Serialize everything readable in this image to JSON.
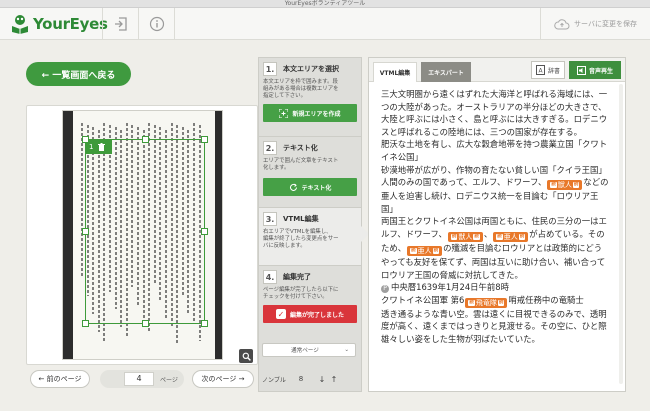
{
  "window": {
    "title": "YourEyesボランティアツール"
  },
  "header": {
    "logo_text": "YourEyes",
    "save_label": "サーバに変更を保存",
    "icons": [
      "exit-icon",
      "info-icon",
      "cloud-upload-icon"
    ]
  },
  "nav": {
    "back_label": "← 一覧画面へ戻る"
  },
  "image_panel": {
    "selection_number": "1",
    "pager": {
      "prev_label": "← 前のページ",
      "page": "4",
      "page_unit": "ページ",
      "next_label": "次のページ →"
    }
  },
  "steps": [
    {
      "num": "1.",
      "title": "本文エリアを選択",
      "desc": "本文エリアを枠で囲みます。段\n組みがある場合は複数エリアを\n指定して下さい。",
      "button": "新規エリアを作成"
    },
    {
      "num": "2.",
      "title": "テキスト化",
      "desc": "エリアで囲んだ文章をテキスト\n化します。",
      "button": "テキスト化"
    },
    {
      "num": "3.",
      "title": "VTML編集",
      "desc": "右エリアでVTMLを編集し、\n編集が終了したら変更点をサー\nバに反映します。",
      "button": ""
    },
    {
      "num": "4.",
      "title": "編集完了",
      "desc": "ページ編集が完了したら以下に\nチェックを付けて下さい。",
      "button": "編集が完了しました"
    }
  ],
  "view_mode": {
    "selected": "通常ページ"
  },
  "bottom_ctl": {
    "label": "ノンブル",
    "value": "8",
    "down": "↓",
    "up": "↑"
  },
  "editor": {
    "tabs": [
      "VTML編集",
      "エキスパート"
    ],
    "dict_label": "辞書",
    "speech_label": "音声再生",
    "tag_label": "読",
    "paragraphs": [
      "三大文明圏から遠くはずれた大海洋と呼ばれる海域には、一つの大陸があった。オーストラリアの半分ほどの大きさで、大陸と呼ぶには小さく、島と呼ぶには大きすぎる。ロデニウスと呼ばれるこの陸地には、三つの国家が存在する。",
      "肥沃な土地を有し、広大な穀倉地帯を持つ農業立国「クワトイネ公国」",
      "砂漠地帯が広がり、作物の育たない貧しい国「クイラ王国」"
    ],
    "p4_a": "人間のみの国であって、エルフ、ドワーフ、",
    "chip_juujin": "獣人",
    "p4_b": "などの亜人を迫害し続け、ロデニウス統一を目論む「ロウリア王国」",
    "p5_a": "両国王とクワトイネ公国は両国ともに、住民の三分の一はエルフ、ドワーフ、",
    "chip_juujin2": "獣人",
    "p5_b": "、",
    "chip_ajin": "亜人",
    "p5_c": "が占めている。そのため、",
    "chip_ajin2": "亜人",
    "p5_d": "の殲滅を目論むロウリアとは政策的にどうやっても友好を保てず、両国は互いに助け合い、補い合ってロウリア王国の脅威に対抗してきた。",
    "p6_pin": "P",
    "p6": "中央暦1639年1月24日午前8時",
    "p7_a": "クワトイネ公国軍 第6",
    "chip_hiryu": "飛竜隊",
    "p7_b": "哨戒任務中の竜騎士",
    "p7_c": "透き通るような青い空。雲は遠くに目視できるのみで、透明度が高く、遠くまではっきりと見渡せる。その空に、ひと際雄々しい姿をした生物が羽ばたいていた。"
  },
  "colors": {
    "brand_green": "#3e9a3a",
    "danger_red": "#d9353b",
    "tag_orange": "#e8782a"
  }
}
